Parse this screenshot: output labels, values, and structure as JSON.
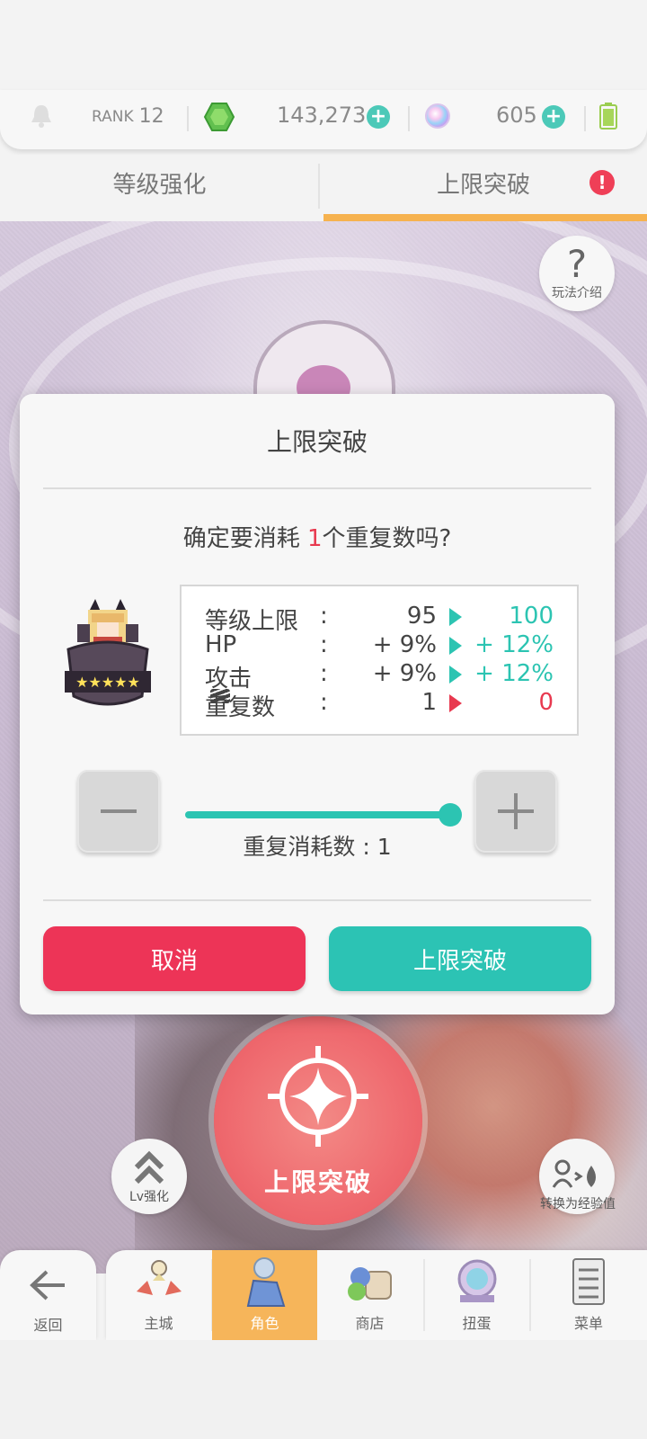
{
  "topbar": {
    "rank_label": "RANK",
    "rank_value": "12",
    "gems": "143,273",
    "orbs": "605"
  },
  "tabs": [
    {
      "label": "等级强化",
      "active": false
    },
    {
      "label": "上限突破",
      "active": true
    }
  ],
  "side": {
    "help_label": "玩法介绍",
    "lv_label": "Lv强化",
    "convert_label": "转换为经验值",
    "big_action_label": "上限突破"
  },
  "modal": {
    "title": "上限突破",
    "confirm_prefix": "确定要消耗 ",
    "confirm_count": "1",
    "confirm_suffix": "个重复数吗?",
    "stats": [
      {
        "label": "等级上限",
        "colon": ":",
        "old": "95",
        "new": "100",
        "trend": "up"
      },
      {
        "label": "HP",
        "colon": ":",
        "old": "+ 9%",
        "new": "+ 12%",
        "trend": "up"
      },
      {
        "label": "攻击",
        "colon": ":",
        "old": "+ 9%",
        "new": "+ 12%",
        "trend": "up"
      },
      {
        "label": "重复数",
        "colon": ":",
        "old": "1",
        "new": "0",
        "trend": "down"
      }
    ],
    "slider_level": 1.0,
    "consume_label": "重复消耗数 : 1",
    "cancel_label": "取消",
    "confirm_label": "上限突破",
    "colors": {
      "accent": "#2cc4b2",
      "danger": "#ed3457"
    }
  },
  "nav": {
    "back_label": "返回",
    "items": [
      {
        "label": "主城",
        "active": false
      },
      {
        "label": "角色",
        "active": true
      },
      {
        "label": "商店",
        "active": false
      },
      {
        "label": "扭蛋",
        "active": false
      },
      {
        "label": "菜单",
        "active": false
      }
    ]
  }
}
